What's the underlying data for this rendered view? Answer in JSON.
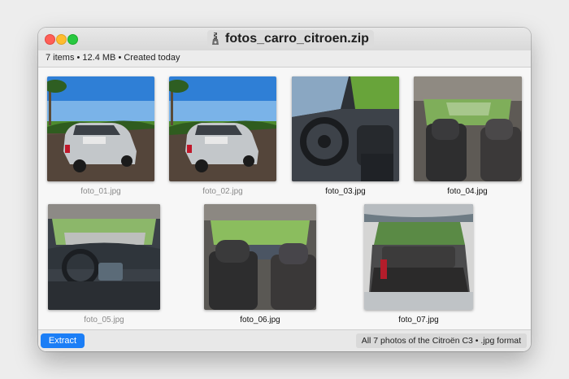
{
  "window": {
    "title": "fotos_carro_citroen.zip",
    "icon": "zip-archive-icon"
  },
  "toolbar": {
    "summary": "7 items • 12.4 MB • Created today"
  },
  "files": [
    {
      "name": "foto_01.jpg",
      "scene": "exterior-rear-left"
    },
    {
      "name": "foto_02.jpg",
      "scene": "exterior-rear-left"
    },
    {
      "name": "foto_03.jpg",
      "scene": "interior-driver-door"
    },
    {
      "name": "foto_04.jpg",
      "scene": "interior-rear-seats"
    },
    {
      "name": "foto_05.jpg",
      "scene": "dashboard"
    },
    {
      "name": "foto_06.jpg",
      "scene": "interior-front-seats"
    },
    {
      "name": "foto_07.jpg",
      "scene": "trunk-open"
    }
  ],
  "bottom": {
    "extract_label": "Extract",
    "info": "All 7 photos of the Citroën C3 • .jpg format"
  },
  "colors": {
    "accent": "#1b7ef6",
    "close": "#ff5f57",
    "minimize": "#febc2e",
    "zoom": "#28c840"
  }
}
